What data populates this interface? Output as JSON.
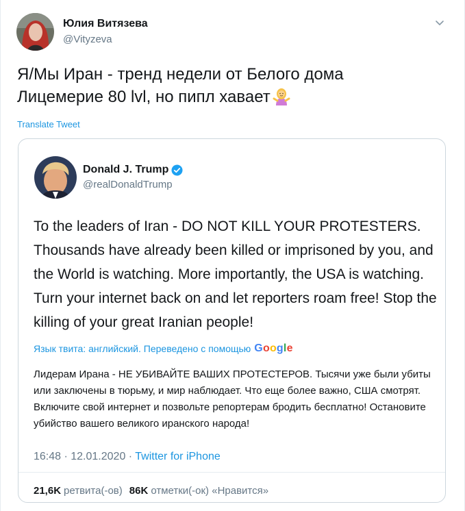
{
  "author": {
    "name": "Юлия Витязева",
    "handle": "@Vityzeva"
  },
  "tweet": {
    "line1": "Я/Мы Иран - тренд недели от Белого дома",
    "line2": "Лицемерие 80 lvl, но пипл хавает",
    "emoji_icon": "woman-shrugging-icon"
  },
  "translate_label": "Translate Tweet",
  "quoted": {
    "name": "Donald J. Trump",
    "handle": "@realDonaldTrump",
    "text": "To the leaders of Iran - DO NOT KILL YOUR PROTESTERS. Thousands have already been killed or imprisoned by you, and the World is watching. More importantly, the USA is watching. Turn your internet back on and let reporters roam free! Stop the killing of your great Iranian people!",
    "lang_note": "Язык твита: английский. Переведено с помощью",
    "google_label": "Google",
    "translation": "Лидерам Ирана - НЕ УБИВАЙТЕ ВАШИХ ПРОТЕСТЕРОВ. Тысячи уже были убиты или заключены в тюрьму, и мир наблюдает. Что еще более важно, США смотрят. Включите свой интернет и позвольте репортерам бродить бесплатно! Остановите убийство вашего великого иранского народа!",
    "time": "16:48 · 12.01.2020 ·",
    "source": "Twitter for iPhone",
    "retweets_count": "21,6K",
    "retweets_label": "ретвита(-ов)",
    "likes_count": "86K",
    "likes_label": "отметки(-ок) «Нравится»"
  },
  "colors": {
    "link": "#1b95e0",
    "secondary": "#657786",
    "border": "#ccd6dd"
  }
}
